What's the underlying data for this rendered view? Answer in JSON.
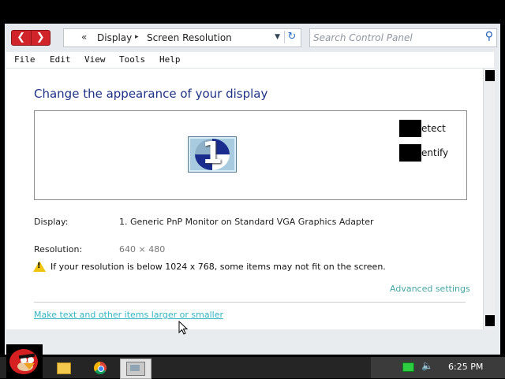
{
  "navigation": {
    "back_icon": "back-arrow-icon",
    "forward_icon": "forward-arrow-icon",
    "back_glyph": "❮",
    "forward_glyph": "❯"
  },
  "address_bar": {
    "chevron": "«",
    "crumbs": [
      "Display",
      "Screen Resolution"
    ],
    "separator": "▸",
    "dropdown_glyph": "▼",
    "refresh_glyph": "↻"
  },
  "search": {
    "placeholder": "Search Control Panel",
    "icon": "search-icon"
  },
  "menu": {
    "items": [
      "File",
      "Edit",
      "View",
      "Tools",
      "Help"
    ]
  },
  "content": {
    "title": "Change the appearance of your display",
    "monitor_number": "1",
    "detect_label": "etect",
    "identify_label": "entify",
    "display_label": "Display:",
    "display_value": "1. Generic PnP Monitor on Standard VGA Graphics Adapter",
    "resolution_label": "Resolution:",
    "resolution_value": "640 × 480",
    "warning_icon": "warning-icon",
    "warning_text": "If your resolution is below 1024 x 768, some items may not fit on the screen.",
    "advanced_link": "Advanced settings",
    "bottom_link": "Make text and other items larger or smaller"
  },
  "taskbar": {
    "start_icon": "angry-bird-start-icon",
    "apps": [
      "file-explorer-icon",
      "chrome-icon",
      "control-panel-icon"
    ],
    "clock": "6:25 PM",
    "tray_icons": [
      "network-icon",
      "volume-icon"
    ]
  },
  "colors": {
    "title": "#1e3287",
    "link": "#33b5c5",
    "advanced_link": "#48a6a6",
    "nav_red": "#d0232a",
    "warning": "#f1c40f"
  }
}
